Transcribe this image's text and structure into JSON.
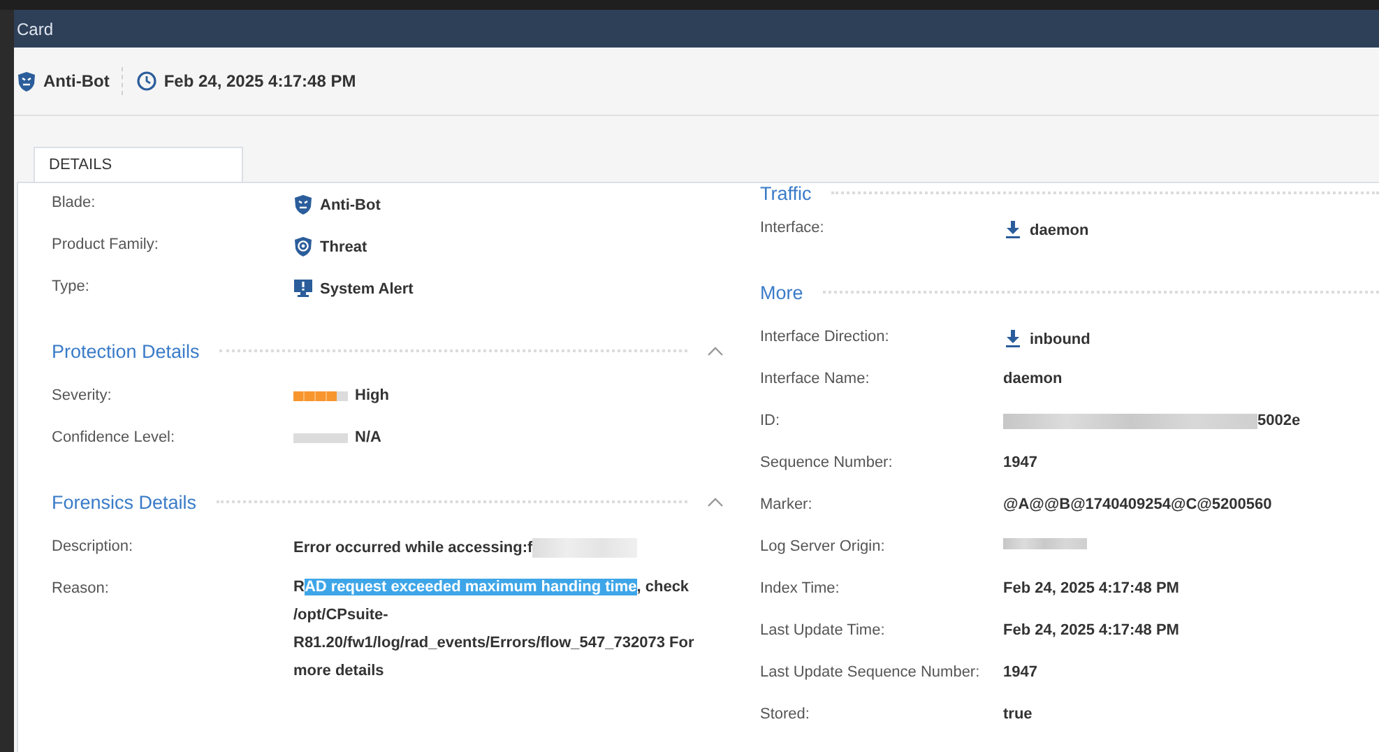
{
  "window": {
    "title": "Card"
  },
  "header": {
    "blade": "Anti-Bot",
    "time": "Feb 24, 2025 4:17:48 PM"
  },
  "tabs": [
    {
      "label": "DETAILS",
      "selected": true
    }
  ],
  "left": [
    {
      "rows": [
        {
          "label": "Blade:",
          "kind": "blade",
          "value": "Anti-Bot"
        },
        {
          "label": "Product Family:",
          "kind": "family",
          "value": "Threat"
        },
        {
          "label": "Type:",
          "kind": "alert",
          "value": "System Alert"
        }
      ]
    },
    {
      "title": "Protection Details",
      "expanded": true,
      "rows": [
        {
          "label": "Severity:",
          "kind": "meter",
          "level": 0.8,
          "value": "High"
        },
        {
          "label": "Confidence Level:",
          "kind": "meter",
          "value": "N/A"
        }
      ]
    },
    {
      "title": "Forensics Details",
      "expanded": true,
      "rows": [
        {
          "label": "Description:",
          "kind": "masked",
          "value": "Error occurred while accessing:f"
        },
        {
          "label": "Reason:",
          "kind": "segments",
          "segments": [
            {
              "text": "R",
              "highlighted": false
            },
            {
              "text": "AD request exceeded maximum handing time",
              "highlighted": true
            },
            {
              "text": ", check /opt/CPsuite-R81.20/fw1/log/rad_events/Errors/flow_547_732073 For more details",
              "highlighted": false
            }
          ]
        }
      ]
    }
  ],
  "right": [
    {
      "title": "Traffic",
      "rows": [
        {
          "label": "Interface:",
          "kind": "direction",
          "value": "daemon"
        }
      ]
    },
    {
      "title": "More",
      "rows": [
        {
          "label": "Interface Direction:",
          "kind": "direction",
          "value": "inbound"
        },
        {
          "label": "Interface Name:",
          "kind": "text",
          "value": "daemon"
        },
        {
          "label": "ID:",
          "kind": "masked-prefix",
          "value": "5002e"
        },
        {
          "label": "Sequence Number:",
          "kind": "text",
          "value": "1947"
        },
        {
          "label": "Marker:",
          "kind": "text",
          "value": "@A@@B@1740409254@C@5200560"
        },
        {
          "label": "Log Server Origin:",
          "kind": "masked-only"
        },
        {
          "label": "Index Time:",
          "kind": "text",
          "value": "Feb 24, 2025 4:17:48 PM"
        },
        {
          "label": "Last Update Time:",
          "kind": "text",
          "value": "Feb 24, 2025 4:17:48 PM"
        },
        {
          "label": "Last Update Sequence Number:",
          "kind": "text",
          "value": "1947"
        },
        {
          "label": "Stored:",
          "kind": "text",
          "value": "true"
        }
      ]
    }
  ]
}
